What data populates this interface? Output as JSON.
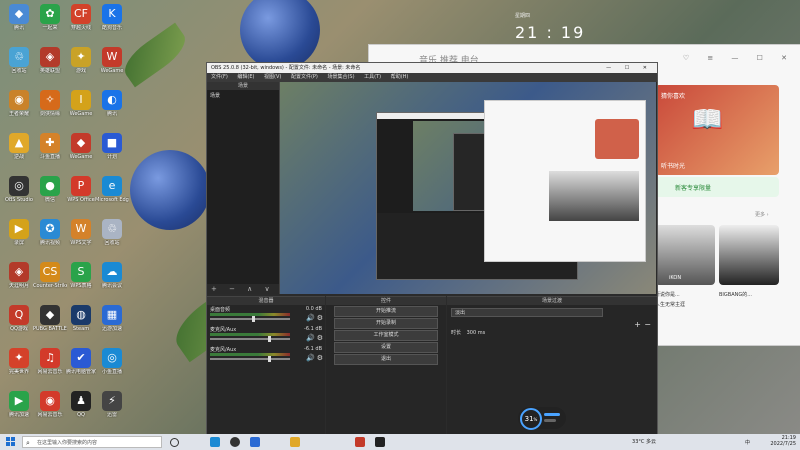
{
  "desktop_icons": [
    {
      "label": "腾讯",
      "color": "#4a8ad4",
      "glyph": "◆"
    },
    {
      "label": "一起来",
      "color": "#2aa34a",
      "glyph": "✿"
    },
    {
      "label": "穿越火线",
      "color": "#d2422a",
      "glyph": "CF"
    },
    {
      "label": "酷狗音乐",
      "color": "#1a73e8",
      "glyph": "K"
    },
    {
      "label": "回收站",
      "color": "#4aa3d4",
      "glyph": "♲"
    },
    {
      "label": "英雄联盟",
      "color": "#b33a2a",
      "glyph": "◈"
    },
    {
      "label": "游戏",
      "color": "#c9a227",
      "glyph": "✦"
    },
    {
      "label": "WeGame",
      "color": "#c33a2a",
      "glyph": "W"
    },
    {
      "label": "王者荣耀",
      "color": "#c9822a",
      "glyph": "◉"
    },
    {
      "label": "剑侠情缘",
      "color": "#d66a1a",
      "glyph": "✧"
    },
    {
      "label": "WeGame",
      "color": "#d4a21a",
      "glyph": "Ⅰ"
    },
    {
      "label": "腾讯",
      "color": "#1a73e8",
      "glyph": "◐"
    },
    {
      "label": "逆战",
      "color": "#e0a82a",
      "glyph": "▲"
    },
    {
      "label": "斗鱼直播",
      "color": "#d4822a",
      "glyph": "✚"
    },
    {
      "label": "WeGame",
      "color": "#c33a2a",
      "glyph": "◆"
    },
    {
      "label": "计划",
      "color": "#2a5ad4",
      "glyph": "■"
    },
    {
      "label": "OBS Studio",
      "color": "#333333",
      "glyph": "◎"
    },
    {
      "label": "微信",
      "color": "#2aa34a",
      "glyph": "●"
    },
    {
      "label": "WPS Office",
      "color": "#d33a2a",
      "glyph": "P"
    },
    {
      "label": "Microsoft Edge",
      "color": "#1a8ad4",
      "glyph": "e"
    },
    {
      "label": "录屏",
      "color": "#d4a21a",
      "glyph": "▶"
    },
    {
      "label": "腾讯视频",
      "color": "#2a8ad4",
      "glyph": "✪"
    },
    {
      "label": "WPS文字",
      "color": "#d4822a",
      "glyph": "W"
    },
    {
      "label": "回收站",
      "color": "#aab4c4",
      "glyph": "♲"
    },
    {
      "label": "天涯明月",
      "color": "#b33a2a",
      "glyph": "◈"
    },
    {
      "label": "Counter-Strike Global",
      "color": "#d48a1a",
      "glyph": "CS"
    },
    {
      "label": "WPS表格",
      "color": "#2aa34a",
      "glyph": "S"
    },
    {
      "label": "腾讯会议",
      "color": "#1a8ad4",
      "glyph": "☁"
    },
    {
      "label": "QQ游戏",
      "color": "#c33a2a",
      "glyph": "Q"
    },
    {
      "label": "PUBG BATTLEGR",
      "color": "#333333",
      "glyph": "◆"
    },
    {
      "label": "Steam",
      "color": "#1a3a6a",
      "glyph": "◍"
    },
    {
      "label": "迅游加速",
      "color": "#2a6ad4",
      "glyph": "▦"
    },
    {
      "label": "完美世界",
      "color": "#d4422a",
      "glyph": "✦"
    },
    {
      "label": "网易云音乐",
      "color": "#d33a2a",
      "glyph": "♫"
    },
    {
      "label": "腾讯电脑管家",
      "color": "#2a5ad4",
      "glyph": "✔"
    },
    {
      "label": "小鱼直播",
      "color": "#1a8ad4",
      "glyph": "◎"
    },
    {
      "label": "腾讯加速",
      "color": "#2aa34a",
      "glyph": "▶"
    },
    {
      "label": "网易云音乐",
      "color": "#d33a2a",
      "glyph": "◉"
    },
    {
      "label": "QQ",
      "color": "#222222",
      "glyph": "♟"
    },
    {
      "label": "迅雷",
      "color": "#444444",
      "glyph": "⚡"
    }
  ],
  "clock_widget": {
    "date": "星期四",
    "time": "21 : 19"
  },
  "music_app": {
    "tabs": "音乐   推荐   电台",
    "window_buttons": "♡ ≡ — ☐ ✕",
    "banner_title": "猜你喜欢",
    "banner_sub": "听书时光",
    "vip_label": "新客专享限量",
    "more": "更多 ›",
    "artist": "iKON",
    "song_caption": "BIGBANG的...",
    "song_caption2": "听说你是...",
    "tagline": "人生无常主涯"
  },
  "obs": {
    "title": "OBS 25.0.8 (32-bit, windows) - 配置文件: 未命名 - 场景: 未命名",
    "window_buttons": "— ☐ ✕",
    "menu": [
      "文件(F)",
      "编辑(E)",
      "视图(V)",
      "配置文件(P)",
      "场景集合(S)",
      "工具(T)",
      "帮助(H)"
    ],
    "scenes_header": "场景",
    "scene_item": "场景",
    "scene_controls": "+ − ∧ ∨",
    "mixer_header": "混音器",
    "mixer_rows": [
      {
        "name": "桌面音频",
        "db": "0.0 dB",
        "level": 0.55
      },
      {
        "name": "麦克风/Aux",
        "db": "-6.1 dB",
        "level": 0.75
      },
      {
        "name": "麦克风/Aux",
        "db": "-6.1 dB",
        "level": 0.75
      }
    ],
    "controls_header": "控件",
    "controls": [
      "开始推流",
      "开始录制",
      "工作室模式",
      "设置",
      "退出"
    ],
    "transitions_header": "场景过渡",
    "transition_value": "淡出",
    "duration_label": "时长",
    "duration_value": "300 ms",
    "perf_value": "31",
    "perf_unit": "%"
  },
  "taskbar": {
    "search_placeholder": "在这里输入你要搜索的内容",
    "weather": "33°C 多云",
    "time": "21:19",
    "date": "2022/7/25",
    "lang": "中"
  }
}
